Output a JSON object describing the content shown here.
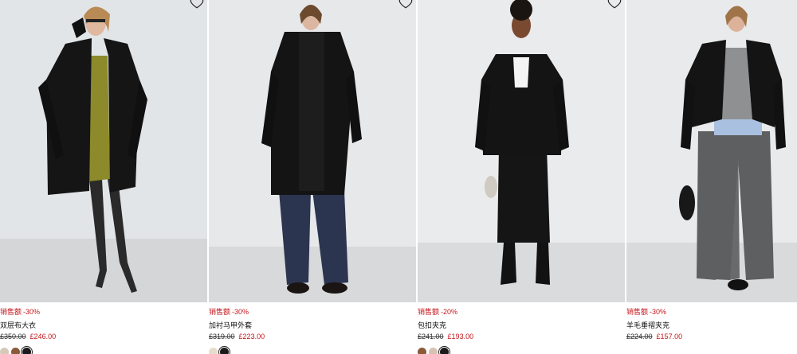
{
  "products": [
    {
      "badge": "销售额",
      "discount": "-30%",
      "name": "双层布大衣",
      "old_price": "£350.00",
      "new_price": "£246.00",
      "swatches": [
        "#d6c9b8",
        "#8a5a3a",
        "#1a1a1a"
      ],
      "selected_swatch": 2,
      "wishlist_icon": "heart-outline-icon"
    },
    {
      "badge": "销售额",
      "discount": "-30%",
      "name": "加衬马甲外套",
      "old_price": "£319.00",
      "new_price": "£223.00",
      "swatches": [
        "#e6dccd",
        "#1a1a1a"
      ],
      "selected_swatch": 1,
      "wishlist_icon": "heart-outline-icon"
    },
    {
      "badge": "销售额",
      "discount": "-20%",
      "name": "包扣夹克",
      "old_price": "£241.00",
      "new_price": "£193.00",
      "swatches": [
        "#8a5a3a",
        "#d6c1b2",
        "#1a1a1a"
      ],
      "selected_swatch": 2,
      "wishlist_icon": "heart-outline-icon"
    },
    {
      "badge": "销售额",
      "discount": "-30%",
      "name": "羊毛垂褶夹克",
      "old_price": "£224.00",
      "new_price": "£157.00",
      "swatches": [],
      "selected_swatch": -1,
      "wishlist_icon": "heart-outline-icon"
    }
  ]
}
